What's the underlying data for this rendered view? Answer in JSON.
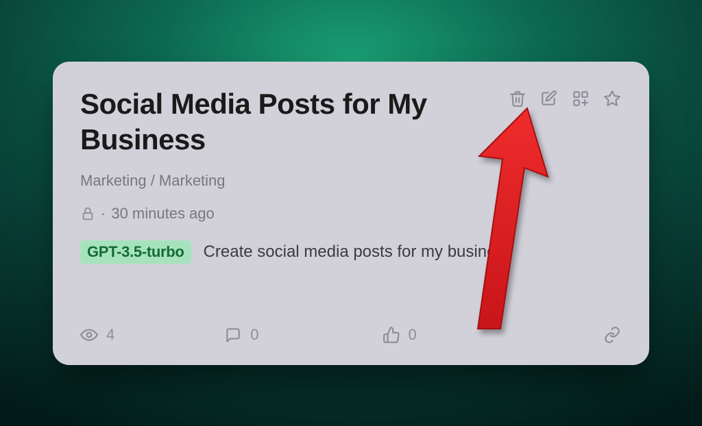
{
  "card": {
    "title": "Social Media Posts for My Business",
    "breadcrumb": "Marketing / Marketing",
    "timestamp": "30 minutes ago",
    "model_badge": "GPT-3.5-turbo",
    "description": "Create social media posts for my business"
  },
  "stats": {
    "views": "4",
    "comments": "0",
    "likes": "0"
  },
  "dot": "·"
}
